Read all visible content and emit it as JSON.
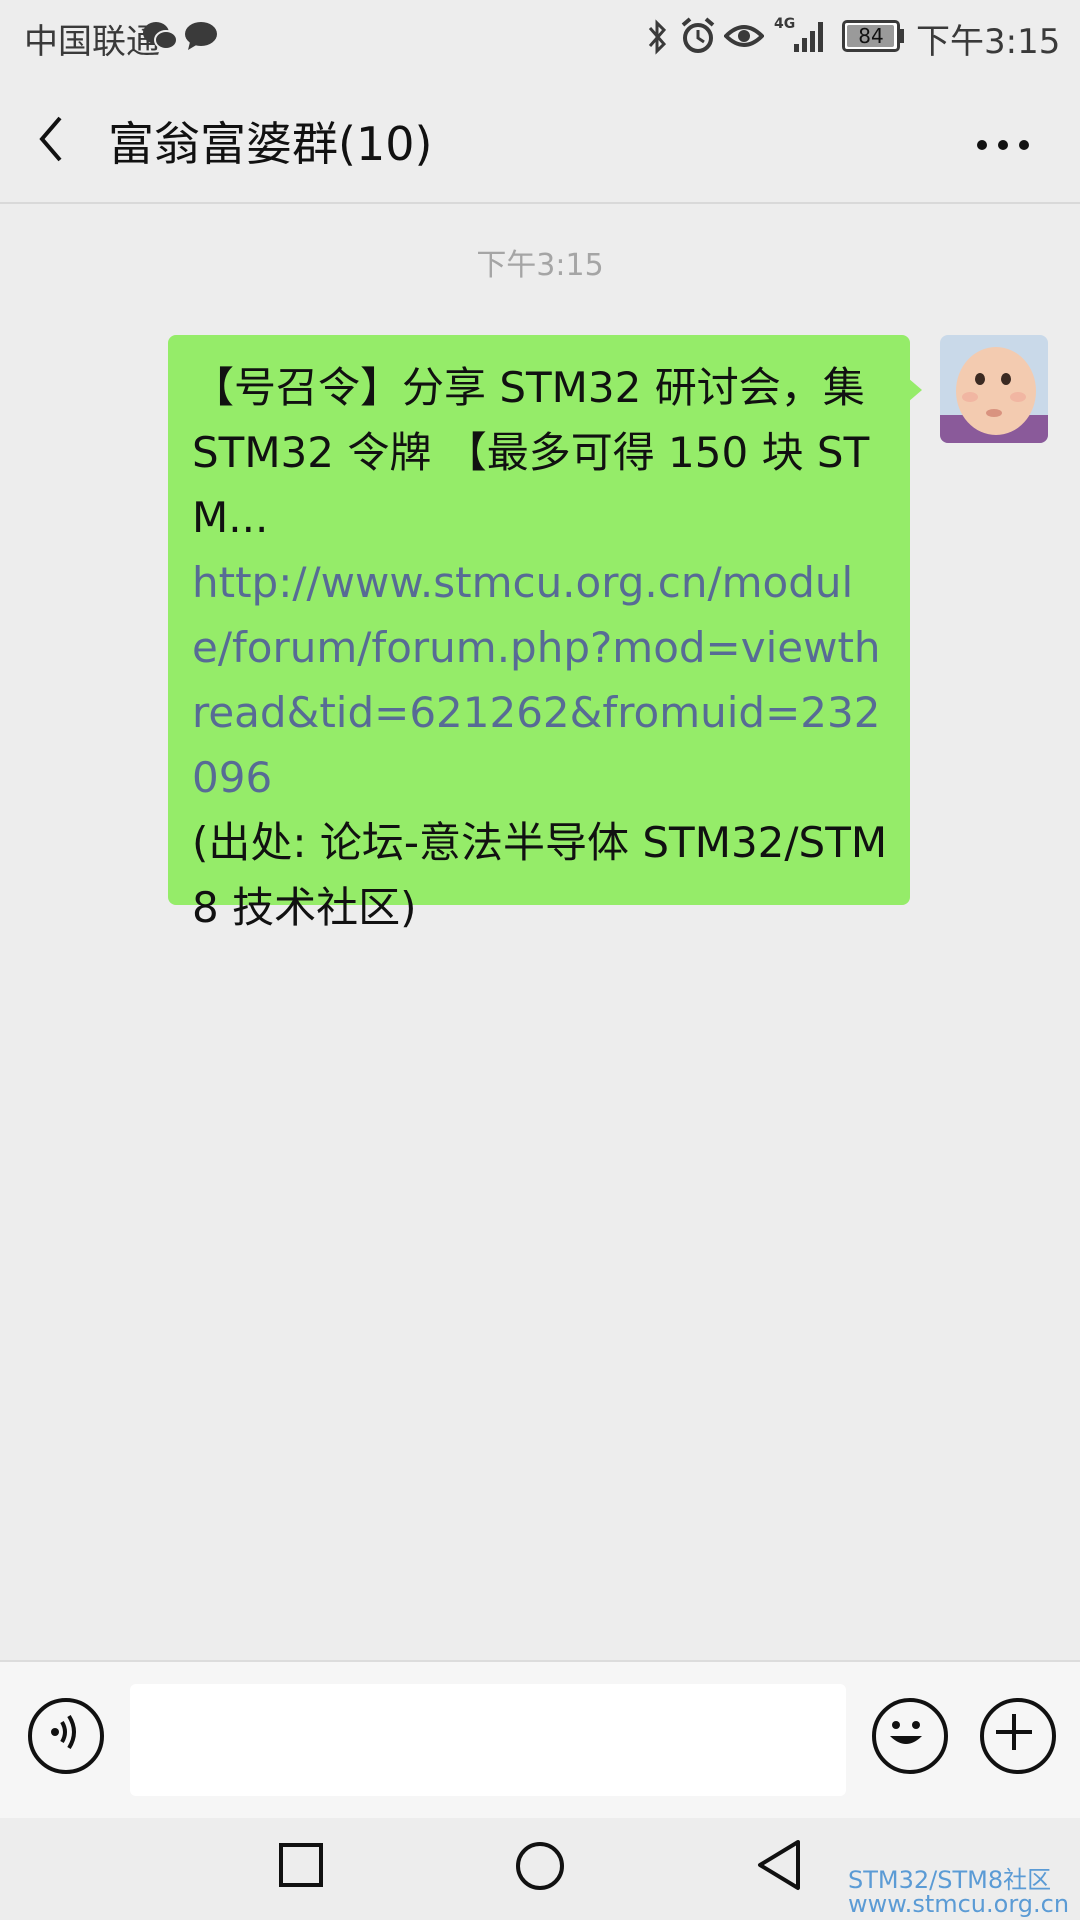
{
  "status_bar": {
    "carrier": "中国联通",
    "battery": "84",
    "network": "4G",
    "time": "下午3:15",
    "icons": [
      "wechat-icon",
      "message-icon",
      "bluetooth-icon",
      "alarm-icon",
      "eye-icon",
      "signal-icon",
      "battery-icon"
    ]
  },
  "header": {
    "back_icon": "chevron-left-icon",
    "title": "富翁富婆群(10)",
    "more_icon": "more-dots-icon"
  },
  "messages": {
    "timestamp": "下午3:15",
    "items": [
      {
        "sender": "self",
        "text_line1": "【号召令】分享 STM32 研讨会，集 STM32 令牌 【最多可得 150 块 STM...",
        "link": "http://www.stmcu.org.cn/module/forum/forum.php?mod=viewthread&tid=621262&fromuid=232096",
        "text_line2": "(出处: 论坛-意法半导体 STM32/STM8 技术社区)"
      }
    ]
  },
  "input_bar": {
    "voice_icon": "voice-icon",
    "emoji_icon": "emoji-icon",
    "plus_icon": "plus-icon",
    "input_value": ""
  },
  "nav_bar": {
    "icons": [
      "recent-apps-icon",
      "home-icon",
      "back-icon"
    ]
  },
  "watermark": {
    "line1": "STM32/STM8社区",
    "line2": "www.stmcu.org.cn"
  },
  "colors": {
    "bubble": "#95ec69",
    "link": "#576b95",
    "background": "#ededed"
  }
}
